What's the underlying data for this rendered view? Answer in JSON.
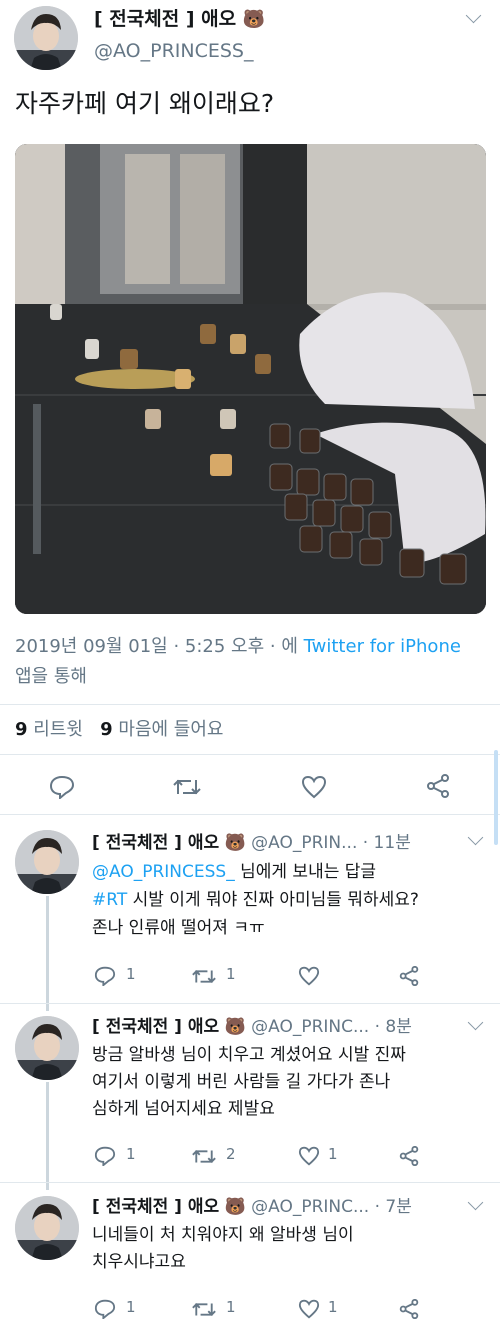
{
  "main_tweet": {
    "display_name": "[ 전국체전 ] 애오",
    "emoji": "🐻",
    "handle": "@AO_PRINCESS_",
    "text": "자주카페 여기 왜이래요?",
    "timestamp": "2019년 09월 01일 · 5:25 오후 · 에",
    "source_link": "Twitter for iPhone",
    "source_suffix": "앱을 통해",
    "retweet_count": "9",
    "retweet_label": "리트윗",
    "like_count": "9",
    "like_label": "마음에 들어요"
  },
  "replies": [
    {
      "display_name": "[ 전국체전 ] 애오",
      "emoji": "🐻",
      "handle": "@AO_PRIN...",
      "time": "· 11분",
      "mention": "@AO_PRINCESS_",
      "reply_to_suffix": "님에게 보내는 답글",
      "hashtag": "#RT",
      "text_after_hashtag": " 시발 이게 뭐야 진짜 아미님들 뭐하세요?",
      "text_line2": "존나 인류애 떨어져 ㅋㅠ",
      "reply_count": "1",
      "retweet_count": "1",
      "like_count": ""
    },
    {
      "display_name": "[ 전국체전 ] 애오",
      "emoji": "🐻",
      "handle": "@AO_PRINC...",
      "time": "· 8분",
      "text_line1": "방금 알바생 님이 치우고 계셨어요 시발 진짜",
      "text_line2": "여기서 이렇게 버린 사람들 길 가다가 존나",
      "text_line3": "심하게 넘어지세요 제발요",
      "reply_count": "1",
      "retweet_count": "2",
      "like_count": "1"
    },
    {
      "display_name": "[ 전국체전 ] 애오",
      "emoji": "🐻",
      "handle": "@AO_PRINC...",
      "time": "· 7분",
      "text_line1": "니네들이 처 치워야지 왜 알바생 님이",
      "text_line2": "치우시냐고요",
      "reply_count": "1",
      "retweet_count": "1",
      "like_count": "1"
    }
  ],
  "icons": {
    "reply": "reply-bubble-icon",
    "retweet": "retweet-icon",
    "like": "heart-icon",
    "share": "share-icon",
    "more": "chevron-down-icon"
  },
  "colors": {
    "link": "#1da1f2",
    "muted": "#657786",
    "text": "#14171a",
    "divider": "#e1e8ed"
  }
}
